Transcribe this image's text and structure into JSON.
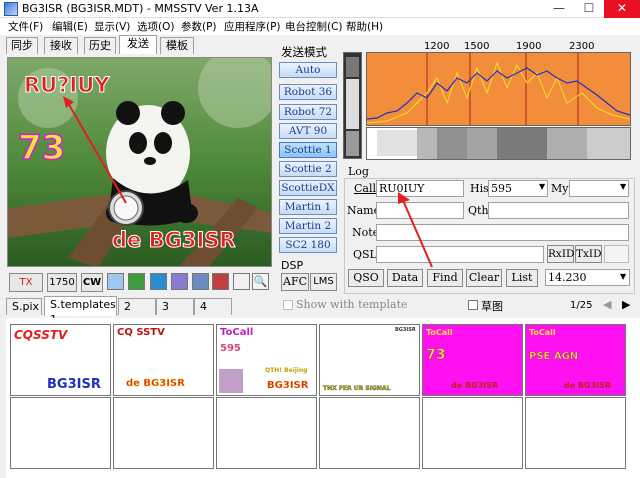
{
  "window": {
    "title": "BG3ISR (BG3ISR.MDT) - MMSSTV Ver 1.13A",
    "controls": {
      "minimize": "—",
      "maximize": "☐",
      "close": "✕"
    }
  },
  "menu": [
    "文件(F)",
    "编辑(E)",
    "显示(V)",
    "选项(O)",
    "参数(P)",
    "应用程序(P)",
    "电台控制(C)",
    "帮助(H)"
  ],
  "tabs": [
    "同步",
    "接收",
    "历史",
    "发送",
    "模板"
  ],
  "active_tab": "发送",
  "picture": {
    "overlay_call": "RU?IUY",
    "overlay_number": "73",
    "overlay_signature": "de BG3ISR"
  },
  "picture_toolbar": {
    "tx_label": "TX",
    "timer_value": "1750",
    "cw_label": "CW"
  },
  "tx_mode": {
    "heading": "发送模式",
    "auto_label": "Auto",
    "modes": [
      "Robot 36",
      "Robot 72",
      "AVT 90",
      "Scottie 1",
      "Scottie 2",
      "ScottieDX",
      "Martin 1",
      "Martin 2",
      "SC2 180"
    ],
    "selected": "Scottie 1"
  },
  "dsp": {
    "heading": "DSP",
    "afc_label": "AFC",
    "lms_label": "LMS"
  },
  "spectrum": {
    "freq_labels": [
      "1200",
      "1500",
      "1900",
      "2300"
    ]
  },
  "log": {
    "heading": "Log",
    "call_label": "Call",
    "call_value": "RU0IUY",
    "his_label": "His",
    "his_value": "595",
    "my_label": "My",
    "my_value": "",
    "name_label": "Name",
    "qth_label": "Qth",
    "note_label": "Note",
    "qsl_label": "QSL",
    "rxid_label": "RxID",
    "txid_label": "TxID",
    "buttons": [
      "QSO",
      "Data",
      "Find",
      "Clear",
      "List"
    ],
    "frequency": "14.230"
  },
  "templates": {
    "tabs": [
      "S.pix",
      "S.templates 1",
      "2",
      "3",
      "4"
    ],
    "active_tab": "S.templates 1",
    "show_with_template_label": "Show with template",
    "draft_label": "草图",
    "page_indicator": "1/25",
    "cells": [
      {
        "lines": [
          "CQSSTV",
          "BG3ISR"
        ]
      },
      {
        "lines": [
          "CQ SSTV",
          "de BG3ISR"
        ]
      },
      {
        "lines": [
          "ToCall",
          "595",
          "QTH! Beijing",
          "BG3ISR"
        ]
      },
      {
        "lines": [
          "BG3ISR",
          "TNX FER UR SIGNAL"
        ]
      },
      {
        "lines": [
          "ToCall",
          "73",
          "de BG3ISR"
        ]
      },
      {
        "lines": [
          "ToCall",
          "PSE AGN",
          "de BG3ISR"
        ]
      }
    ]
  },
  "colors": {
    "accent_blue": "#1c3c8c",
    "spectrum_bg": "#f28d3c",
    "magenta_tpl": "#ff10f0",
    "red_text": "#e02020"
  }
}
